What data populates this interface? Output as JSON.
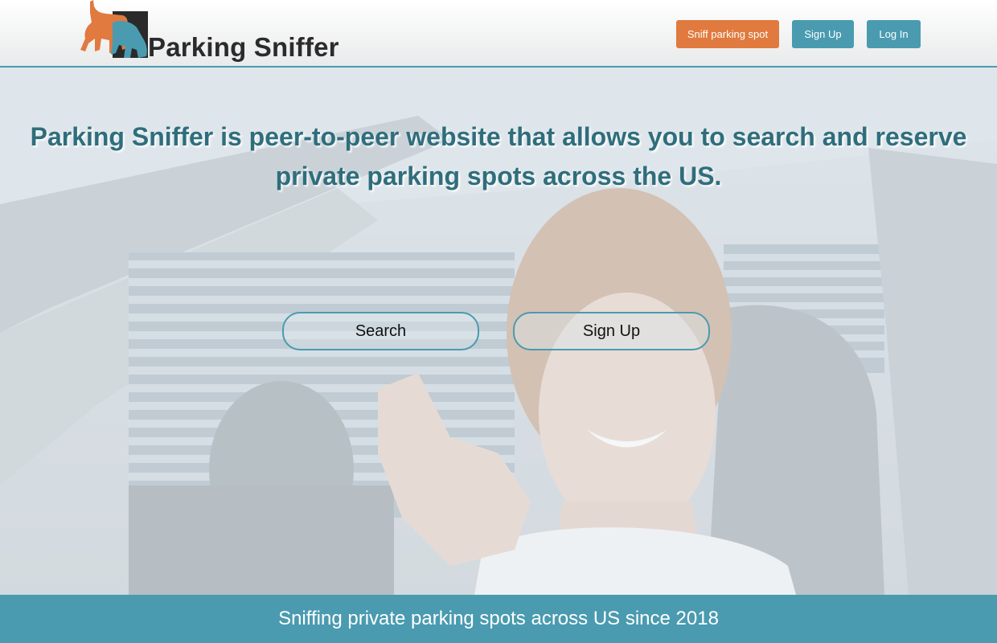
{
  "header": {
    "logo_text": "Parking Sniffer",
    "nav": {
      "sniff_label": "Sniff parking spot",
      "signup_label": "Sign Up",
      "login_label": "Log In"
    }
  },
  "hero": {
    "headline_line1": "Parking Sniffer is peer-to-peer website that allows you to search and reserve",
    "headline_line2": "private parking spots across the US.",
    "search_label": "Search",
    "signup_label": "Sign Up"
  },
  "footer": {
    "tagline": "Sniffing private parking spots across US since 2018"
  },
  "colors": {
    "accent": "#4a9bb0",
    "orange": "#e07a3e",
    "headline": "#2f6e7c"
  }
}
